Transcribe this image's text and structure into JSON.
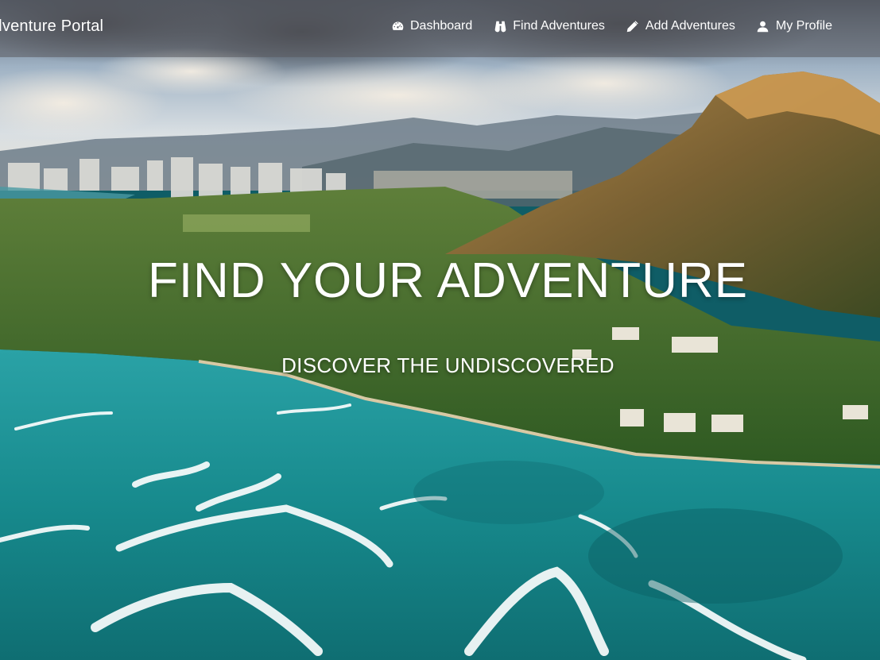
{
  "navbar": {
    "brand": "Adventure Portal",
    "links": [
      {
        "label": "Dashboard",
        "icon": "dashboard-icon"
      },
      {
        "label": "Find Adventures",
        "icon": "binoculars-icon"
      },
      {
        "label": "Add Adventures",
        "icon": "pencil-icon"
      },
      {
        "label": "My Profile",
        "icon": "user-icon"
      }
    ]
  },
  "hero": {
    "title": "FIND YOUR ADVENTURE",
    "subtitle": "DISCOVER THE UNDISCOVERED"
  },
  "colors": {
    "navbar_bg": "#5a5a5f",
    "text": "#ffffff",
    "ocean": "#1a8c8f",
    "mountain": "#6b5a32"
  }
}
